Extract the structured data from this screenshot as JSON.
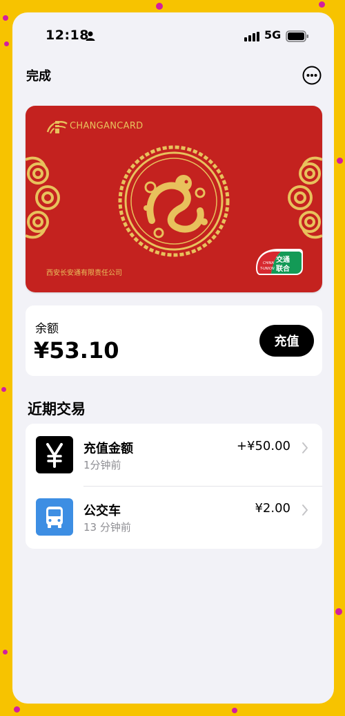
{
  "status_bar": {
    "time": "12:18",
    "network": "5G"
  },
  "nav": {
    "done_label": "完成",
    "more_icon": "ellipsis-circle-icon"
  },
  "card": {
    "brand": "CHANGANCARD",
    "company": "西安长安通有限责任公司",
    "badge_text_cn_1": "交通",
    "badge_text_cn_2": "联合",
    "badge_text_en_1": "CHINA",
    "badge_text_en_2": "T-UNION",
    "colors": {
      "background": "#c4221f",
      "gold": "#e8c15c"
    }
  },
  "balance": {
    "label": "余额",
    "value": "¥53.10",
    "topup_label": "充值"
  },
  "transactions": {
    "title": "近期交易",
    "items": [
      {
        "title": "充值金额",
        "time": "1分钟前",
        "amount": "+¥50.00",
        "icon": "yen-icon"
      },
      {
        "title": "公交车",
        "time": "13 分钟前",
        "amount": "¥2.00",
        "icon": "bus-icon"
      }
    ]
  },
  "colors": {
    "page_background": "#f7c300",
    "screen_background": "#f2f2f7",
    "bus_icon_background": "#3d8ee3",
    "secondary_text": "#8e8e93"
  }
}
